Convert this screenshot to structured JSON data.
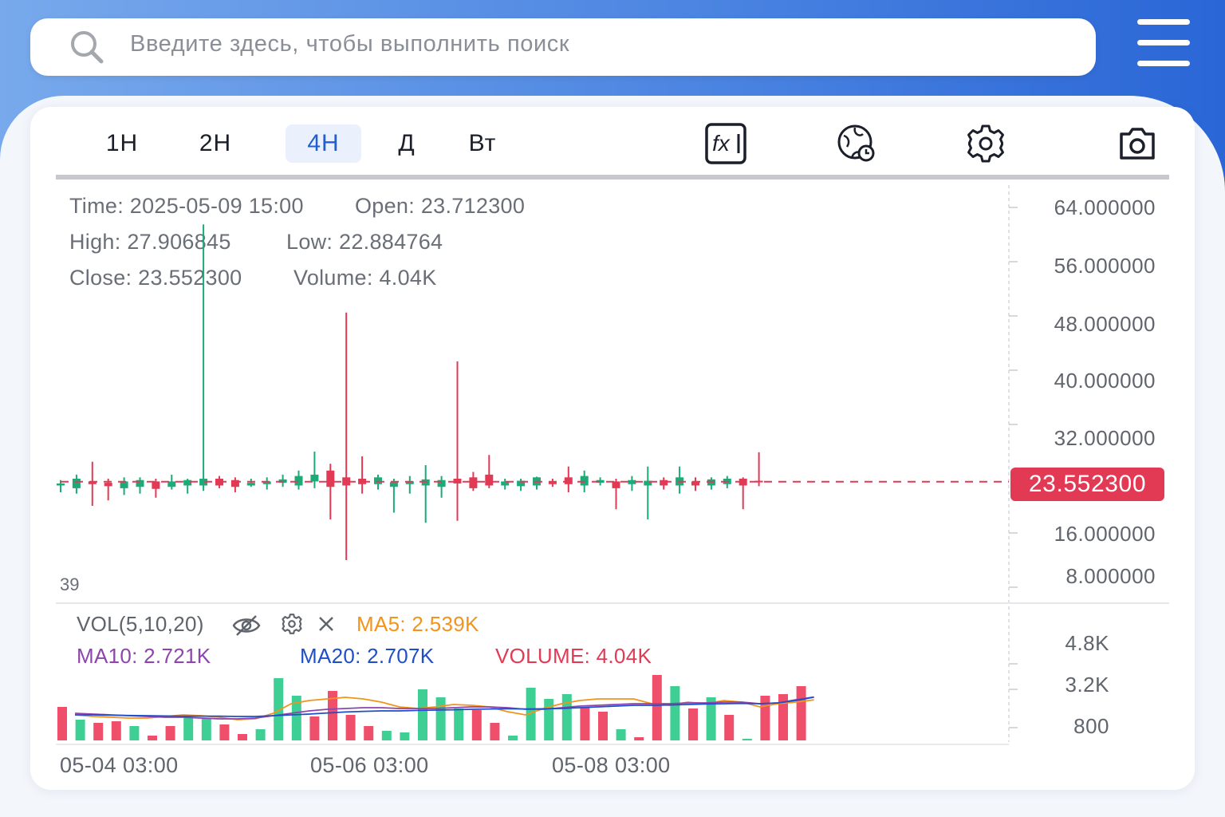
{
  "search": {
    "placeholder": "Введите здесь, чтобы выполнить поиск"
  },
  "timeframes": [
    {
      "label": "1H",
      "active": false
    },
    {
      "label": "2H",
      "active": false
    },
    {
      "label": "4H",
      "active": true
    },
    {
      "label": "Д",
      "active": false
    },
    {
      "label": "Вт",
      "active": false
    }
  ],
  "tools": [
    "fx-indicator-icon",
    "globe-clock-icon",
    "gear-icon",
    "camera-icon"
  ],
  "info": {
    "time": "Time: 2025-05-09 15:00",
    "open": "Open: 23.712300",
    "high": "High: 27.906845",
    "low": "Low: 22.884764",
    "close": "Close: 23.552300",
    "volume": "Volume: 4.04K"
  },
  "price_axis": [
    "64.000000",
    "56.000000",
    "48.000000",
    "40.000000",
    "32.000000",
    "16.000000",
    "8.000000"
  ],
  "last_price": "23.552300",
  "bar_count_label": "39",
  "volume_panel": {
    "title": "VOL(5,10,20)",
    "ma5": "MA5: 2.539K",
    "ma10": "MA10: 2.721K",
    "ma20": "MA20: 2.707K",
    "volume": "VOLUME: 4.04K",
    "axis": [
      "4.8K",
      "3.2K",
      "800"
    ]
  },
  "time_axis": [
    "05-04 03:00",
    "05-06 03:00",
    "05-08 03:00"
  ],
  "colors": {
    "up": "#1aab78",
    "down": "#e23a55",
    "accent": "#1f5fd1",
    "ma5": "#f2941c",
    "ma10": "#8e44ad",
    "ma20": "#1f4fc8"
  },
  "chart_data": {
    "type": "candlestick",
    "y_range": [
      0,
      70
    ],
    "candles": [
      {
        "o": 23.0,
        "h": 23.8,
        "l": 22.0,
        "c": 23.3
      },
      {
        "o": 22.6,
        "h": 24.6,
        "l": 21.8,
        "c": 24.0
      },
      {
        "o": 23.6,
        "h": 26.5,
        "l": 20.0,
        "c": 23.2
      },
      {
        "o": 23.4,
        "h": 24.0,
        "l": 20.8,
        "c": 22.9
      },
      {
        "o": 22.6,
        "h": 24.2,
        "l": 21.6,
        "c": 23.6
      },
      {
        "o": 22.8,
        "h": 24.2,
        "l": 21.8,
        "c": 23.8
      },
      {
        "o": 23.6,
        "h": 24.0,
        "l": 21.2,
        "c": 22.5
      },
      {
        "o": 22.8,
        "h": 24.6,
        "l": 22.4,
        "c": 23.6
      },
      {
        "o": 23.0,
        "h": 24.0,
        "l": 21.8,
        "c": 23.8
      },
      {
        "o": 23.0,
        "h": 61.5,
        "l": 22.2,
        "c": 24.0
      },
      {
        "o": 24.0,
        "h": 24.4,
        "l": 22.6,
        "c": 23.0
      },
      {
        "o": 23.8,
        "h": 24.2,
        "l": 22.0,
        "c": 22.8
      },
      {
        "o": 23.0,
        "h": 24.0,
        "l": 22.8,
        "c": 23.4
      },
      {
        "o": 23.2,
        "h": 24.2,
        "l": 22.4,
        "c": 23.6
      },
      {
        "o": 23.4,
        "h": 24.6,
        "l": 22.8,
        "c": 23.9
      },
      {
        "o": 23.0,
        "h": 25.2,
        "l": 22.4,
        "c": 24.4
      },
      {
        "o": 23.6,
        "h": 28.0,
        "l": 22.6,
        "c": 24.6
      },
      {
        "o": 25.2,
        "h": 26.2,
        "l": 18.0,
        "c": 22.8
      },
      {
        "o": 24.2,
        "h": 48.5,
        "l": 12.0,
        "c": 23.0
      },
      {
        "o": 24.0,
        "h": 27.3,
        "l": 21.8,
        "c": 23.2
      },
      {
        "o": 23.2,
        "h": 24.6,
        "l": 22.4,
        "c": 24.2
      },
      {
        "o": 22.8,
        "h": 24.0,
        "l": 19.0,
        "c": 23.5
      },
      {
        "o": 23.2,
        "h": 24.4,
        "l": 21.8,
        "c": 23.6
      },
      {
        "o": 23.0,
        "h": 26.0,
        "l": 17.5,
        "c": 23.9
      },
      {
        "o": 22.8,
        "h": 24.4,
        "l": 21.2,
        "c": 23.8
      },
      {
        "o": 24.0,
        "h": 41.3,
        "l": 17.8,
        "c": 23.3
      },
      {
        "o": 24.2,
        "h": 25.0,
        "l": 22.2,
        "c": 22.6
      },
      {
        "o": 24.6,
        "h": 27.5,
        "l": 22.6,
        "c": 23.0
      },
      {
        "o": 23.0,
        "h": 24.0,
        "l": 22.4,
        "c": 23.6
      },
      {
        "o": 22.9,
        "h": 24.0,
        "l": 22.2,
        "c": 23.7
      },
      {
        "o": 23.0,
        "h": 24.3,
        "l": 22.4,
        "c": 24.2
      },
      {
        "o": 23.6,
        "h": 24.0,
        "l": 22.8,
        "c": 23.2
      },
      {
        "o": 24.2,
        "h": 25.8,
        "l": 22.0,
        "c": 23.2
      },
      {
        "o": 23.0,
        "h": 25.2,
        "l": 22.0,
        "c": 24.4
      },
      {
        "o": 23.4,
        "h": 24.2,
        "l": 23.0,
        "c": 23.8
      },
      {
        "o": 23.6,
        "h": 24.0,
        "l": 19.5,
        "c": 22.6
      },
      {
        "o": 23.2,
        "h": 24.4,
        "l": 22.2,
        "c": 23.8
      },
      {
        "o": 23.0,
        "h": 25.8,
        "l": 18.0,
        "c": 23.7
      },
      {
        "o": 23.8,
        "h": 24.2,
        "l": 22.4,
        "c": 23.0
      },
      {
        "o": 23.0,
        "h": 25.8,
        "l": 21.8,
        "c": 24.2
      },
      {
        "o": 23.6,
        "h": 24.2,
        "l": 22.2,
        "c": 23.0
      },
      {
        "o": 23.0,
        "h": 24.2,
        "l": 22.4,
        "c": 23.9
      },
      {
        "o": 23.2,
        "h": 24.4,
        "l": 22.6,
        "c": 24.0
      },
      {
        "o": 24.0,
        "h": 24.2,
        "l": 19.5,
        "c": 23.0
      },
      {
        "o": 23.7,
        "h": 27.9,
        "l": 22.9,
        "c": 23.6
      }
    ],
    "volume": [
      {
        "v": 2.1,
        "up": false
      },
      {
        "v": 1.3,
        "up": true
      },
      {
        "v": 1.1,
        "up": false
      },
      {
        "v": 1.2,
        "up": false
      },
      {
        "v": 0.9,
        "up": true
      },
      {
        "v": 0.3,
        "up": false
      },
      {
        "v": 0.9,
        "up": false
      },
      {
        "v": 1.4,
        "up": true
      },
      {
        "v": 1.4,
        "up": true
      },
      {
        "v": 1.0,
        "up": false
      },
      {
        "v": 0.4,
        "up": false
      },
      {
        "v": 0.7,
        "up": true
      },
      {
        "v": 3.9,
        "up": true
      },
      {
        "v": 2.8,
        "up": true
      },
      {
        "v": 1.5,
        "up": false
      },
      {
        "v": 3.1,
        "up": false
      },
      {
        "v": 1.6,
        "up": false
      },
      {
        "v": 0.9,
        "up": false
      },
      {
        "v": 0.6,
        "up": true
      },
      {
        "v": 0.5,
        "up": true
      },
      {
        "v": 3.2,
        "up": true
      },
      {
        "v": 2.7,
        "up": true
      },
      {
        "v": 2.0,
        "up": true
      },
      {
        "v": 1.9,
        "up": false
      },
      {
        "v": 1.1,
        "up": false
      },
      {
        "v": 0.3,
        "up": true
      },
      {
        "v": 3.3,
        "up": true
      },
      {
        "v": 2.6,
        "up": true
      },
      {
        "v": 2.9,
        "up": true
      },
      {
        "v": 2.1,
        "up": false
      },
      {
        "v": 1.8,
        "up": false
      },
      {
        "v": 0.7,
        "up": true
      },
      {
        "v": 0.2,
        "up": false
      },
      {
        "v": 4.1,
        "up": false
      },
      {
        "v": 3.4,
        "up": true
      },
      {
        "v": 2.0,
        "up": false
      },
      {
        "v": 2.7,
        "up": true
      },
      {
        "v": 1.6,
        "up": false
      },
      {
        "v": 0.1,
        "up": true
      },
      {
        "v": 2.8,
        "up": false
      },
      {
        "v": 2.9,
        "up": false
      },
      {
        "v": 3.4,
        "up": false
      }
    ],
    "volume_y_range": [
      0,
      6.0
    ],
    "ma5": [
      1.6,
      1.5,
      1.45,
      1.4,
      1.4,
      1.5,
      1.6,
      1.55,
      1.45,
      1.3,
      1.35,
      1.7,
      2.3,
      2.5,
      2.6,
      2.7,
      2.6,
      2.4,
      2.1,
      2.0,
      2.1,
      2.25,
      2.2,
      2.1,
      1.8,
      1.6,
      2.0,
      2.3,
      2.5,
      2.6,
      2.6,
      2.6,
      2.3,
      2.2,
      2.4,
      2.3,
      2.5,
      2.4,
      2.1,
      2.3,
      2.4,
      2.54
    ],
    "ma10": [
      1.7,
      1.65,
      1.6,
      1.55,
      1.5,
      1.45,
      1.45,
      1.4,
      1.35,
      1.35,
      1.4,
      1.55,
      1.7,
      1.85,
      1.95,
      2.0,
      2.05,
      2.05,
      2.0,
      2.0,
      2.0,
      2.05,
      2.1,
      2.1,
      2.05,
      1.95,
      1.95,
      2.05,
      2.15,
      2.2,
      2.25,
      2.3,
      2.3,
      2.3,
      2.35,
      2.35,
      2.4,
      2.4,
      2.3,
      2.35,
      2.55,
      2.72
    ],
    "ma20": [
      1.6,
      1.6,
      1.58,
      1.56,
      1.55,
      1.53,
      1.52,
      1.52,
      1.52,
      1.5,
      1.5,
      1.55,
      1.6,
      1.65,
      1.72,
      1.78,
      1.82,
      1.85,
      1.85,
      1.88,
      1.9,
      1.92,
      1.95,
      1.97,
      1.98,
      1.97,
      1.98,
      2.0,
      2.05,
      2.1,
      2.15,
      2.2,
      2.2,
      2.22,
      2.25,
      2.28,
      2.3,
      2.32,
      2.3,
      2.35,
      2.5,
      2.71
    ]
  }
}
